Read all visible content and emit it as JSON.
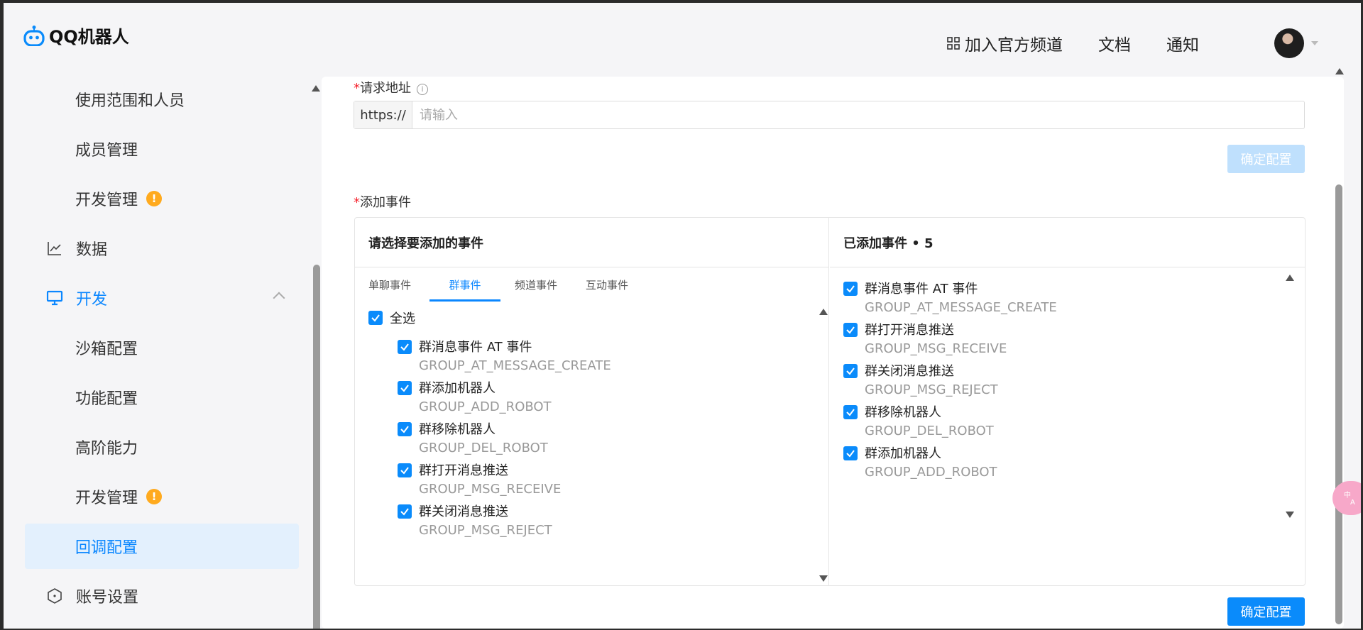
{
  "app": {
    "name": "QQ机器人"
  },
  "header": {
    "nav": [
      {
        "label": "加入官方频道",
        "icon": "grid-icon"
      },
      {
        "label": "文档"
      },
      {
        "label": "通知"
      }
    ]
  },
  "sidebar": {
    "items": [
      {
        "label": "使用范围和人员",
        "level": "sub"
      },
      {
        "label": "成员管理",
        "level": "sub"
      },
      {
        "label": "开发管理",
        "level": "sub",
        "badge": "!"
      },
      {
        "label": "数据",
        "level": "top",
        "icon": "chart-icon"
      },
      {
        "label": "开发",
        "level": "top",
        "icon": "monitor-icon",
        "expanded": true
      },
      {
        "label": "沙箱配置",
        "level": "sub"
      },
      {
        "label": "功能配置",
        "level": "sub"
      },
      {
        "label": "高阶能力",
        "level": "sub"
      },
      {
        "label": "开发管理",
        "level": "sub",
        "badge": "!"
      },
      {
        "label": "回调配置",
        "level": "sub",
        "active": true
      },
      {
        "label": "账号设置",
        "level": "top",
        "icon": "hexagon-icon"
      }
    ]
  },
  "form": {
    "url_label": "请求地址",
    "required_mark": "*",
    "url_prefix": "https://",
    "url_placeholder": "请输入",
    "url_value": "",
    "confirm_top": "确定配置",
    "events_label": "添加事件",
    "confirm_bottom": "确定配置"
  },
  "transfer": {
    "left_title": "请选择要添加的事件",
    "right_title": "已添加事件 • 5",
    "tabs": [
      "单聊事件",
      "群事件",
      "频道事件",
      "互动事件"
    ],
    "active_tab": "群事件",
    "select_all": "全选",
    "left_events": [
      {
        "name": "群消息事件 AT 事件",
        "code": "GROUP_AT_MESSAGE_CREATE",
        "checked": true
      },
      {
        "name": "群添加机器人",
        "code": "GROUP_ADD_ROBOT",
        "checked": true
      },
      {
        "name": "群移除机器人",
        "code": "GROUP_DEL_ROBOT",
        "checked": true
      },
      {
        "name": "群打开消息推送",
        "code": "GROUP_MSG_RECEIVE",
        "checked": true
      },
      {
        "name": "群关闭消息推送",
        "code": "GROUP_MSG_REJECT",
        "checked": true
      }
    ],
    "right_events": [
      {
        "name": "群消息事件 AT 事件",
        "code": "GROUP_AT_MESSAGE_CREATE",
        "checked": true
      },
      {
        "name": "群打开消息推送",
        "code": "GROUP_MSG_RECEIVE",
        "checked": true
      },
      {
        "name": "群关闭消息推送",
        "code": "GROUP_MSG_REJECT",
        "checked": true
      },
      {
        "name": "群移除机器人",
        "code": "GROUP_DEL_ROBOT",
        "checked": true
      },
      {
        "name": "群添加机器人",
        "code": "GROUP_ADD_ROBOT",
        "checked": true
      }
    ]
  },
  "floating": {
    "translate_icon": "translate-icon"
  },
  "colors": {
    "accent": "#0a8bfb",
    "active_bg": "#e3f0fd",
    "warn": "#ffaa1e",
    "required": "#f5222d"
  }
}
